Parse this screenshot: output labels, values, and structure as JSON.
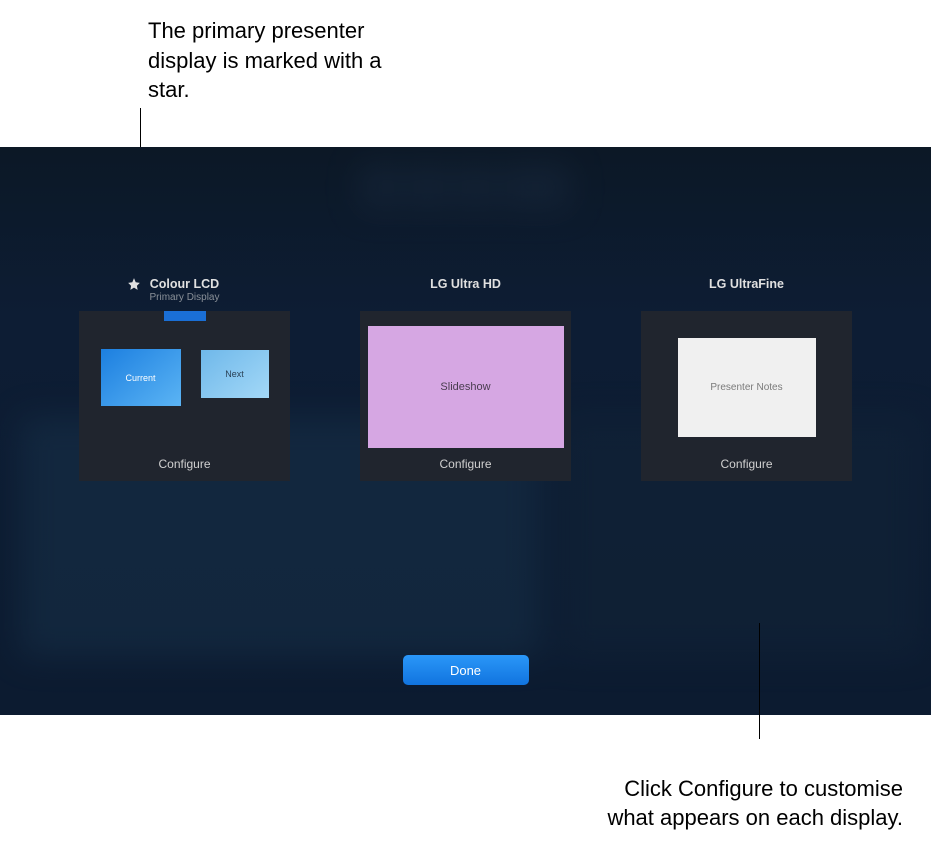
{
  "annotations": {
    "top": "The primary presenter display is marked with a star.",
    "bottom": "Click Configure to customise what appears on each display."
  },
  "displays": [
    {
      "name": "Colour LCD",
      "subtitle": "Primary Display",
      "is_primary": true,
      "preview_type": "presenter",
      "current_label": "Current",
      "next_label": "Next",
      "configure": "Configure"
    },
    {
      "name": "LG Ultra HD",
      "subtitle": "",
      "is_primary": false,
      "preview_type": "slideshow",
      "slideshow_label": "Slideshow",
      "configure": "Configure"
    },
    {
      "name": "LG UltraFine",
      "subtitle": "",
      "is_primary": false,
      "preview_type": "notes",
      "notes_label": "Presenter Notes",
      "configure": "Configure"
    }
  ],
  "buttons": {
    "done": "Done"
  }
}
